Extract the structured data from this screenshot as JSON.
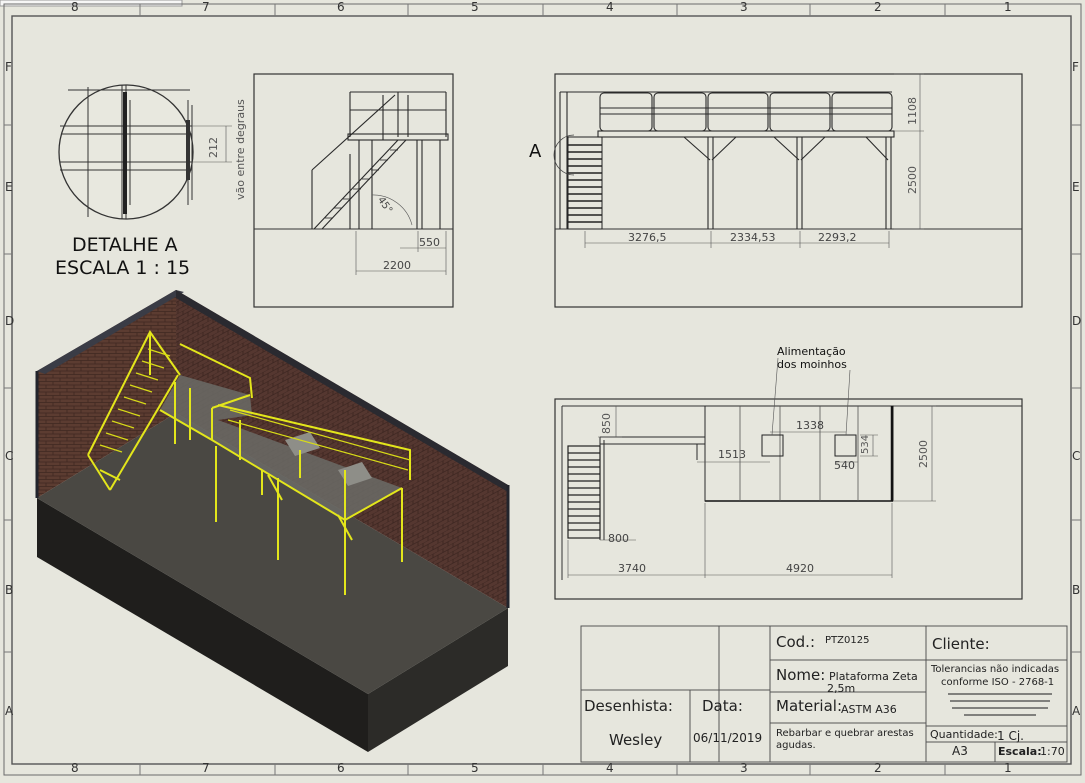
{
  "zones": {
    "columns": [
      "8",
      "7",
      "6",
      "5",
      "4",
      "3",
      "2",
      "1"
    ],
    "rows": [
      "F",
      "E",
      "D",
      "C",
      "B",
      "A"
    ]
  },
  "detail": {
    "title_line1": "DETALHE A",
    "title_line2": "ESCALA 1 : 15",
    "dim_value": "212",
    "dim_caption": "vão entre degraus"
  },
  "side_view": {
    "dim_550": "550",
    "dim_2200": "2200",
    "angle": "45°"
  },
  "front_view": {
    "marker": "A",
    "dim_height_top": "1108",
    "dim_height": "2500",
    "dim_spans": [
      "3276,5",
      "2334,53",
      "2293,2"
    ]
  },
  "top_view": {
    "callout_line1": "Alimentação",
    "callout_line2": "dos moinhos",
    "dim_850": "850",
    "dim_1513": "1513",
    "dim_1338": "1338",
    "dim_534": "534",
    "dim_540": "540",
    "dim_2500": "2500",
    "dim_800": "800",
    "dim_3740": "3740",
    "dim_4920": "4920"
  },
  "title_block": {
    "cod_label": "Cod.:",
    "cod_value": "PTZ0125",
    "cliente_label": "Cliente:",
    "nome_label": "Nome:",
    "nome_value_line1": "Plataforma Zeta",
    "nome_value_line2": "2,5m",
    "tolerance_line1": "Tolerancias não indicadas",
    "tolerance_line2": "conforme ISO - 2768-1",
    "desenhista_label": "Desenhista:",
    "desenhista_value": "Wesley",
    "data_label": "Data:",
    "data_value": "06/11/2019",
    "material_label": "Material:",
    "material_value": "ASTM A36",
    "note_line1": "Rebarbar e quebrar arestas",
    "note_line2": "agudas.",
    "quantidade_label": "Quantidade:",
    "quantidade_value": "1 Cj.",
    "formato_value": "A3",
    "escala_label": "Escala:",
    "escala_value": "1:70"
  },
  "colors": {
    "sheet": "#e6e6dd",
    "line": "#3a3a3a",
    "steel": "#e3e61b",
    "brick": "#5a3a30",
    "floor": "#3c3a36"
  }
}
